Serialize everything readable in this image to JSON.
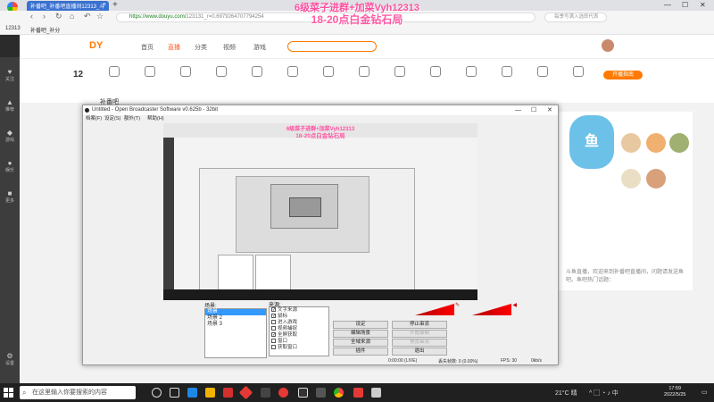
{
  "browser": {
    "tab_title": "补番吧_补番吧直播间12313_斗",
    "url_secure": "https://www.douyu.com/",
    "url_rest": "123131_r=0.6979264707794254",
    "search_placeholder": "每季写满入选即代表",
    "bookmarks": [
      "12313",
      "补番吧_补分"
    ]
  },
  "overlay": {
    "line1": "6级菜子进群+加菜Vyh12313",
    "line2": "18-20点白金钻石局"
  },
  "site": {
    "nav": [
      "首页",
      "直播",
      "分类",
      "视频",
      "游戏",
      "鱼吧"
    ],
    "stat_number": "12",
    "user_name": "补番吧",
    "promo_button": "开播指南",
    "right_text": "斗鱼直播，欢迎来到补番吧直播间，问题请发送鱼吧。鱼吧热门话题：",
    "hot": "热门"
  },
  "sidebar": [
    "关注",
    "推荐",
    "游戏",
    "娱乐",
    "更多",
    "设置"
  ],
  "obs": {
    "title": "Untitled - Open Broadcaster Software v0.625b - 32bit",
    "menu": [
      "档案(F)",
      "设定(S)",
      "额外(T)",
      "帮助(H)"
    ],
    "scenes_label": "场景:",
    "scenes": [
      "场景",
      "场景 2",
      "场景 3"
    ],
    "sources_label": "来源:",
    "sources": [
      "文字来源",
      "鼠标",
      "进入游戏",
      "视频捕捉",
      "全屏获取",
      "窗口",
      "获取窗口"
    ],
    "buttons_left": [
      "设定",
      "编辑场景",
      "全域来源",
      "插件"
    ],
    "buttons_right": [
      "停止串流",
      "开始录制",
      "预览串流",
      "退出"
    ],
    "status_time": "0:00:00 (LIVE)",
    "status_drop": "丢失帧数: 0 (0.00%)",
    "status_fps": "FPS: 30",
    "status_rate": "0kb/s"
  },
  "taskbar": {
    "search": "在这里输入你要搜索的内容",
    "weather": "21°C 晴",
    "time": "17:59",
    "date": "2022/5/25"
  }
}
